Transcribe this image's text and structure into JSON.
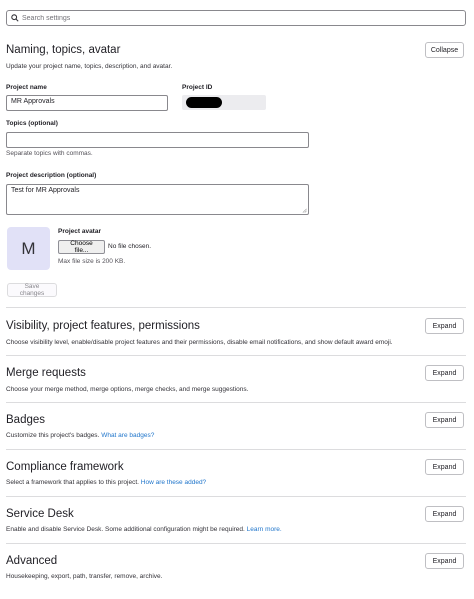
{
  "search": {
    "placeholder": "Search settings"
  },
  "naming": {
    "title": "Naming, topics, avatar",
    "description": "Update your project name, topics, description, and avatar.",
    "collapse_label": "Collapse",
    "project_name_label": "Project name",
    "project_name_value": "MR Approvals",
    "project_id_label": "Project ID",
    "topics_label": "Topics (optional)",
    "topics_value": "",
    "topics_hint": "Separate topics with commas.",
    "project_description_label": "Project description (optional)",
    "project_description_value": "Test for MR Approvals",
    "avatar_letter": "M",
    "avatar_label": "Project avatar",
    "choose_file_label": "Choose file...",
    "no_file_text": "No file chosen.",
    "max_size_text": "Max file size is 200 KB.",
    "save_label": "Save changes"
  },
  "sections": [
    {
      "title": "Visibility, project features, permissions",
      "description": "Choose visibility level, enable/disable project features and their permissions, disable email notifications, and show default award emoji.",
      "link": "",
      "button": "Expand"
    },
    {
      "title": "Merge requests",
      "description": "Choose your merge method, merge options, merge checks, and merge suggestions.",
      "link": "",
      "button": "Expand"
    },
    {
      "title": "Badges",
      "description": "Customize this project's badges.",
      "link": "What are badges?",
      "button": "Expand"
    },
    {
      "title": "Compliance framework",
      "description": "Select a framework that applies to this project.",
      "link": "How are these added?",
      "button": "Expand"
    },
    {
      "title": "Service Desk",
      "description": "Enable and disable Service Desk. Some additional configuration might be required.",
      "link": "Learn more.",
      "button": "Expand"
    },
    {
      "title": "Advanced",
      "description": "Housekeeping, export, path, transfer, remove, archive.",
      "link": "",
      "button": "Expand"
    }
  ],
  "icons": {
    "search": "search-icon",
    "resize": "resize-handle-icon"
  }
}
